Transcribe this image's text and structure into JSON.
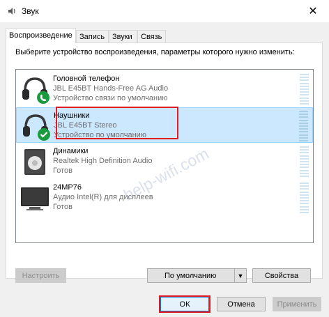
{
  "window": {
    "title": "Звук",
    "close_glyph": "✕"
  },
  "tabs": [
    {
      "label": "Воспроизведение",
      "active": true
    },
    {
      "label": "Запись",
      "active": false
    },
    {
      "label": "Звуки",
      "active": false
    },
    {
      "label": "Связь",
      "active": false
    }
  ],
  "instruction": "Выберите устройство воспроизведения, параметры которого нужно изменить:",
  "devices": [
    {
      "name": "Головной телефон",
      "model": "JBL E45BT Hands-Free AG Audio",
      "status": "Устройство связи по умолчанию",
      "icon": "headset-phone-icon",
      "selected": false
    },
    {
      "name": "Наушники",
      "model": "JBL E45BT Stereo",
      "status": "Устройство по умолчанию",
      "icon": "headphones-default-icon",
      "selected": true
    },
    {
      "name": "Динамики",
      "model": "Realtek High Definition Audio",
      "status": "Готов",
      "icon": "speaker-icon",
      "selected": false
    },
    {
      "name": "24MP76",
      "model": "Аудио Intel(R) для дисплеев",
      "status": "Готов",
      "icon": "monitor-icon",
      "selected": false
    }
  ],
  "watermark": "help-wifi.com",
  "buttons": {
    "configure": "Настроить",
    "set_default": "По умолчанию",
    "properties": "Свойства",
    "ok": "ОК",
    "cancel": "Отмена",
    "apply": "Применить"
  },
  "colors": {
    "selection_bg": "#cce8ff",
    "highlight_red": "#e21b23",
    "check_green": "#1a9c3e"
  }
}
